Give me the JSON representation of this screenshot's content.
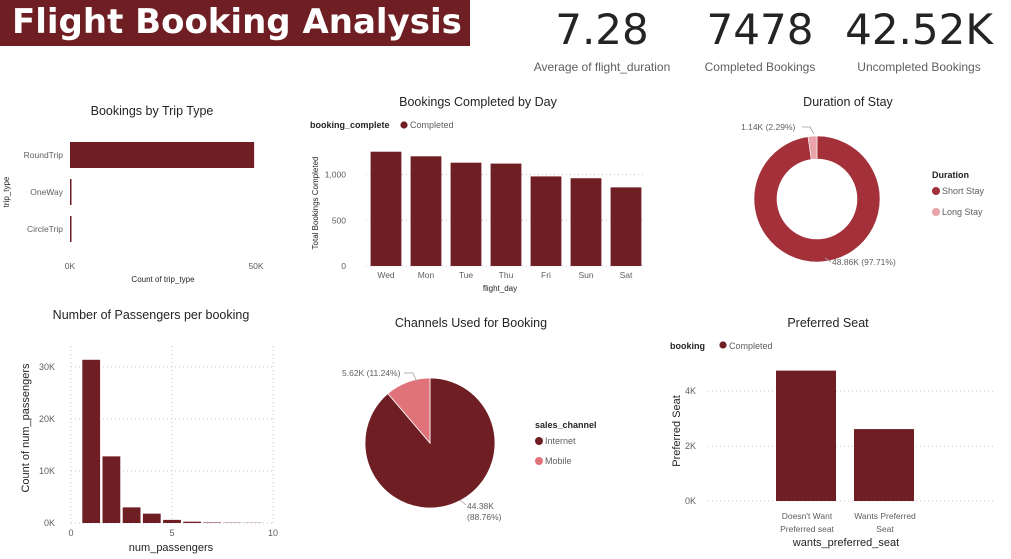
{
  "dashboard": {
    "title": "Flight Booking Analysis"
  },
  "kpis": [
    {
      "value": "7.28",
      "label": "Average of flight_duration"
    },
    {
      "value": "7478",
      "label": "Completed Bookings"
    },
    {
      "value": "42.52K",
      "label": "Uncompleted Bookings"
    }
  ],
  "colors": {
    "primary": "#6f1f24",
    "secondary": "#e07379",
    "stay_short": "#a4303a",
    "stay_long": "#e9a4aa"
  },
  "chart_data": [
    {
      "type": "bar",
      "orientation": "horizontal",
      "title": "Bookings by Trip Type",
      "categories": [
        "RoundTrip",
        "OneWay",
        "CircleTrip"
      ],
      "values": [
        49500,
        390,
        120
      ],
      "xlabel": "Count of trip_type",
      "ylabel": "trip_type",
      "x_ticks": [
        "0K",
        "50K"
      ],
      "xlim": [
        0,
        50000
      ]
    },
    {
      "type": "bar",
      "title": "Bookings Completed by Day",
      "legend_title": "booking_complete",
      "series": [
        {
          "name": "Completed",
          "values": [
            1250,
            1200,
            1130,
            1120,
            980,
            960,
            860
          ]
        }
      ],
      "categories": [
        "Wed",
        "Mon",
        "Tue",
        "Thu",
        "Fri",
        "Sun",
        "Sat"
      ],
      "xlabel": "flight_day",
      "ylabel": "Total Bookings Completed",
      "y_ticks": [
        "0",
        "500",
        "1,000"
      ],
      "ylim": [
        0,
        1400
      ]
    },
    {
      "type": "pie",
      "donut": true,
      "title": "Duration of Stay",
      "legend_title": "Duration",
      "labels": [
        "Short Stay",
        "Long Stay"
      ],
      "values": [
        48860,
        1140
      ],
      "data_labels": [
        "48.86K (97.71%)",
        "1.14K (2.29%)"
      ]
    },
    {
      "type": "bar",
      "title": "Number of Passengers per booking",
      "categories": [
        1,
        2,
        3,
        4,
        5,
        6,
        7,
        8,
        9
      ],
      "values": [
        31350,
        12800,
        3000,
        1800,
        600,
        250,
        100,
        60,
        40
      ],
      "xlabel": "num_passengers",
      "ylabel": "Count of num_passengers",
      "y_ticks": [
        "0K",
        "10K",
        "20K",
        "30K"
      ],
      "x_ticks": [
        "0",
        "5",
        "10"
      ],
      "ylim": [
        0,
        34000
      ],
      "xlim": [
        0,
        10
      ]
    },
    {
      "type": "pie",
      "title": "Channels Used for Booking",
      "legend_title": "sales_channel",
      "labels": [
        "Internet",
        "Mobile"
      ],
      "values": [
        44380,
        5620
      ],
      "data_labels": [
        "44.38K (88.76%)",
        "5.62K (11.24%)"
      ]
    },
    {
      "type": "bar",
      "title": "Preferred Seat",
      "legend_title": "booking",
      "series": [
        {
          "name": "Completed",
          "values": [
            4750,
            2620
          ]
        }
      ],
      "categories": [
        "Doesn't Want Preferred seat",
        "Wants Preferred Seat"
      ],
      "xlabel": "wants_preferred_seat",
      "ylabel": "Preferred Seat",
      "y_ticks": [
        "0K",
        "2K",
        "4K"
      ],
      "ylim": [
        0,
        5100
      ]
    }
  ]
}
